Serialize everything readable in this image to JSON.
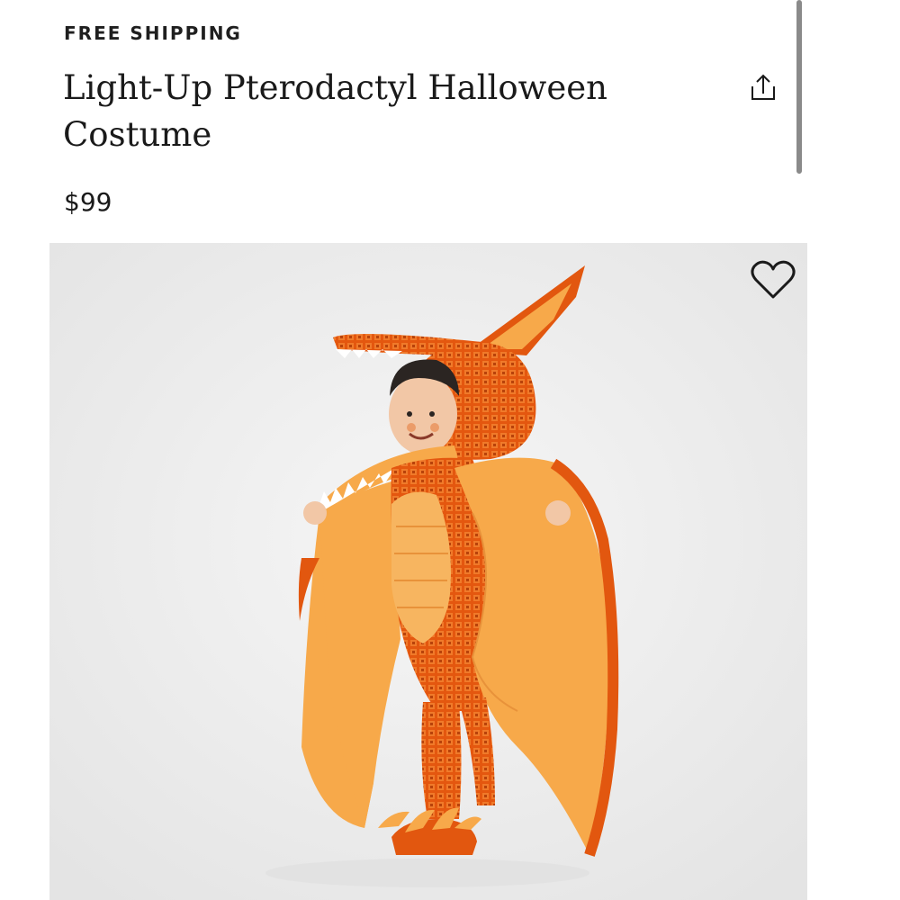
{
  "banner": {
    "shipping_label": "FREE SHIPPING"
  },
  "product": {
    "title": "Light-Up Pterodactyl Halloween Costume",
    "price": "$99"
  },
  "icons": {
    "share": "share-icon",
    "favorite": "heart-icon"
  },
  "colors": {
    "costume_orange": "#f5a03a",
    "costume_dark_orange": "#e2570f",
    "background": "#eeeeee"
  }
}
